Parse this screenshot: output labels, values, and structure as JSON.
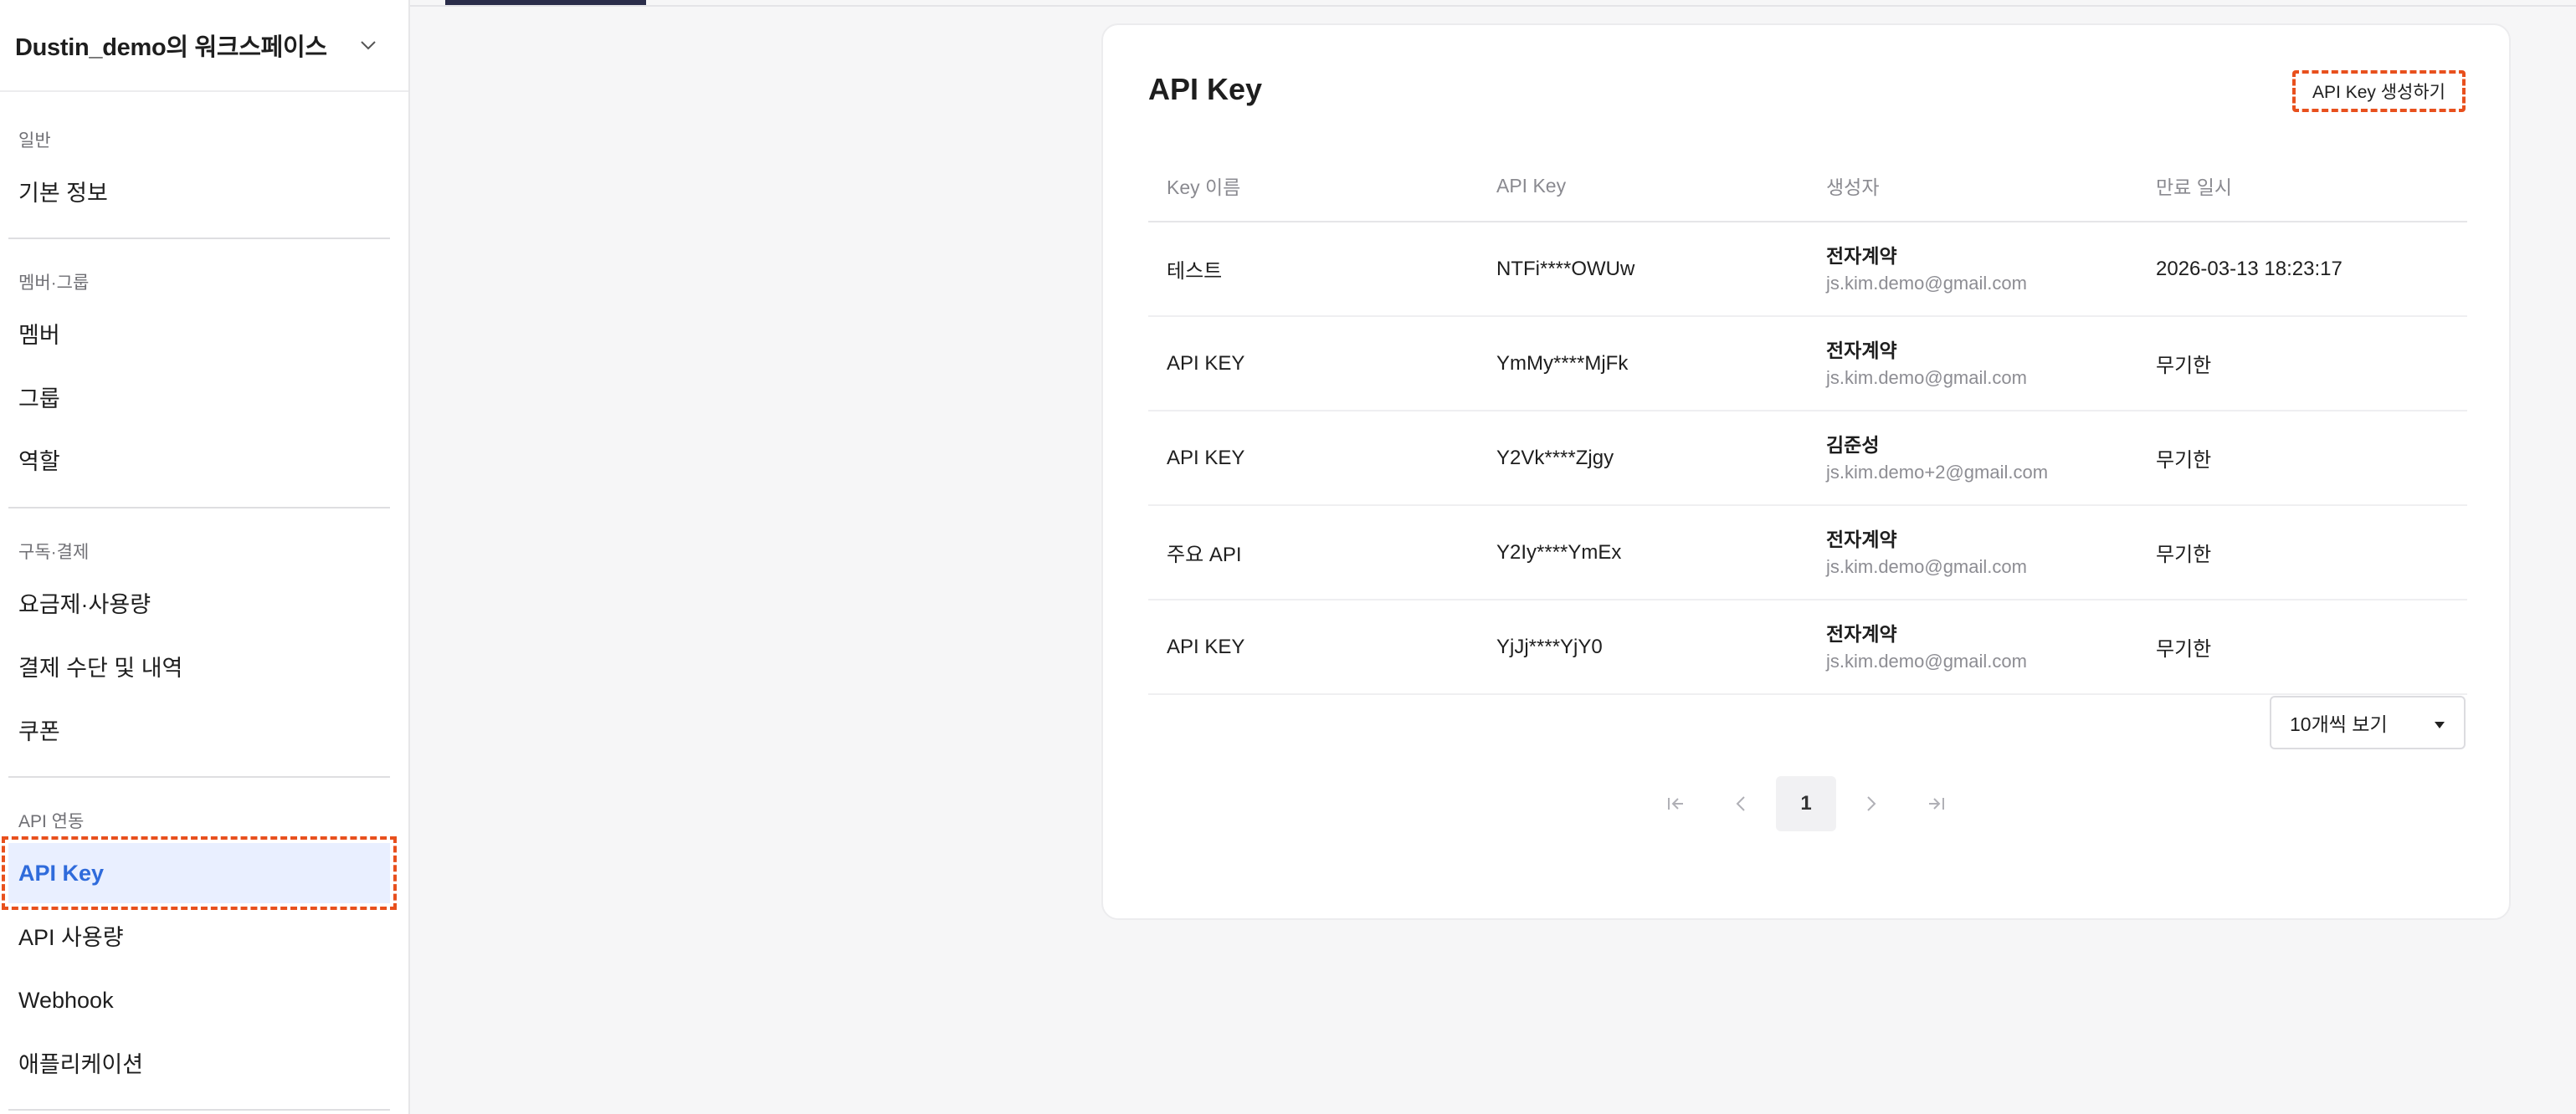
{
  "workspace": {
    "title": "Dustin_demo의 워크스페이스"
  },
  "sidebar": {
    "sections": [
      {
        "label": "일반",
        "items": [
          "기본 정보"
        ]
      },
      {
        "label": "멤버·그룹",
        "items": [
          "멤버",
          "그룹",
          "역할"
        ]
      },
      {
        "label": "구독·결제",
        "items": [
          "요금제·사용량",
          "결제 수단 및 내역",
          "쿠폰"
        ]
      },
      {
        "label": "API 연동",
        "items": [
          "API Key",
          "API 사용량",
          "Webhook",
          "애플리케이션"
        ]
      }
    ],
    "active_item": "API Key"
  },
  "card": {
    "title": "API Key",
    "create_button": "API Key 생성하기",
    "columns": [
      "Key 이름",
      "API Key",
      "생성자",
      "만료 일시"
    ],
    "rows": [
      {
        "name": "테스트",
        "key": "NTFi****OWUw",
        "creator": "전자계약",
        "email": "js.kim.demo@gmail.com",
        "expires": "2026-03-13 18:23:17"
      },
      {
        "name": "API KEY",
        "key": "YmMy****MjFk",
        "creator": "전자계약",
        "email": "js.kim.demo@gmail.com",
        "expires": "무기한"
      },
      {
        "name": "API KEY",
        "key": "Y2Vk****Zjgy",
        "creator": "김준성",
        "email": "js.kim.demo+2@gmail.com",
        "expires": "무기한"
      },
      {
        "name": "주요 API",
        "key": "Y2Iy****YmEx",
        "creator": "전자계약",
        "email": "js.kim.demo@gmail.com",
        "expires": "무기한"
      },
      {
        "name": "API KEY",
        "key": "YjJj****YjY0",
        "creator": "전자계약",
        "email": "js.kim.demo@gmail.com",
        "expires": "무기한"
      }
    ],
    "page_size": "10개씩 보기",
    "current_page": "1"
  },
  "icons": {
    "workspace_toggle": "chevron-down-icon",
    "page_size_toggle": "caret-down-icon",
    "first_page": "first-page-icon",
    "prev_page": "chevron-left-icon",
    "next_page": "chevron-right-icon",
    "last_page": "last-page-icon"
  },
  "colors": {
    "accent": "#2f6bdb",
    "active_bg": "#e9efff",
    "highlight": "#e8501d"
  }
}
